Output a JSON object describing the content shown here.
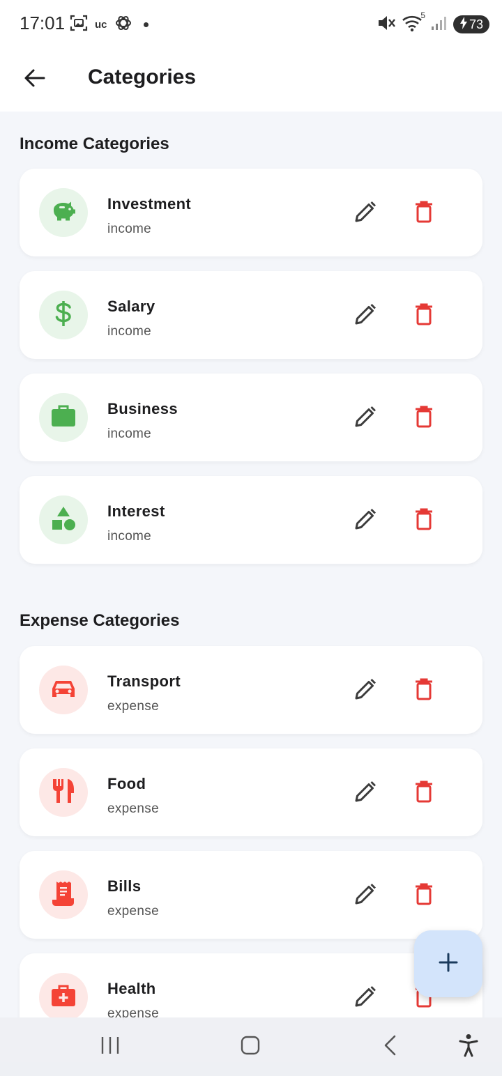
{
  "status": {
    "time": "17:01",
    "uc_label": "uc",
    "signal_label": "5",
    "battery": "73"
  },
  "appbar": {
    "title": "Categories"
  },
  "income": {
    "title": "Income Categories",
    "items": [
      {
        "name": "Investment",
        "type": "income",
        "icon": "piggy-bank-icon"
      },
      {
        "name": "Salary",
        "type": "income",
        "icon": "dollar-icon"
      },
      {
        "name": "Business",
        "type": "income",
        "icon": "briefcase-icon"
      },
      {
        "name": "Interest",
        "type": "income",
        "icon": "shapes-icon"
      }
    ]
  },
  "expense": {
    "title": "Expense Categories",
    "items": [
      {
        "name": "Transport",
        "type": "expense",
        "icon": "car-icon"
      },
      {
        "name": "Food",
        "type": "expense",
        "icon": "restaurant-icon"
      },
      {
        "name": "Bills",
        "type": "expense",
        "icon": "receipt-icon"
      },
      {
        "name": "Health",
        "type": "expense",
        "icon": "medical-kit-icon"
      }
    ]
  },
  "colors": {
    "income_icon": "#4caf50",
    "income_bg": "#e8f5e9",
    "expense_icon": "#f44336",
    "expense_bg": "#fde8e6",
    "delete": "#e53935",
    "edit": "#3c3c3c",
    "fab_bg": "#d3e4fb",
    "fab_icon": "#1a3a5c"
  }
}
